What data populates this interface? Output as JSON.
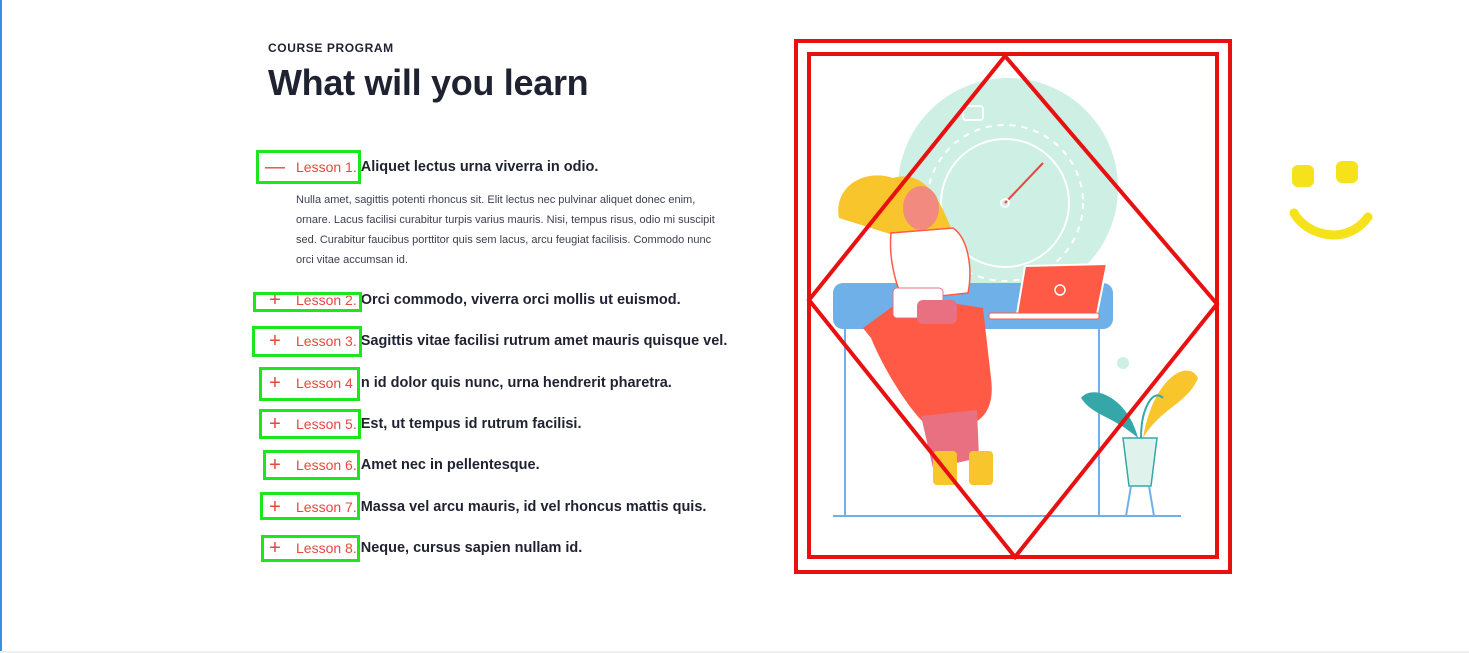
{
  "section": {
    "eyebrow": "COURSE PROGRAM",
    "title": "What will you learn"
  },
  "lessons": [
    {
      "number": "Lesson 1.",
      "title": "Aliquet lectus urna viverra in odio.",
      "toggle": "minus-icon",
      "expanded": true,
      "body": "Nulla amet, sagittis potenti rhoncus sit. Elit lectus nec pulvinar aliquet donec enim, ornare. Lacus facilisi curabitur turpis varius mauris. Nisi, tempus risus, odio mi suscipit sed. Curabitur faucibus porttitor quis sem lacus, arcu feugiat facilisis. Commodo nunc orci vitae accumsan id."
    },
    {
      "number": "Lesson 2.",
      "title": "Orci commodo, viverra orci mollis ut euismod.",
      "toggle": "plus-icon",
      "expanded": false
    },
    {
      "number": "Lesson 3.",
      "title": "Sagittis vitae facilisi rutrum amet mauris quisque vel.",
      "toggle": "plus-icon",
      "expanded": false
    },
    {
      "number": "Lesson 4",
      "title": "In id dolor quis nunc, urna hendrerit pharetra.",
      "toggle": "plus-icon",
      "expanded": false
    },
    {
      "number": "Lesson 5.",
      "title": "Est, ut tempus id rutrum facilisi.",
      "toggle": "plus-icon",
      "expanded": false
    },
    {
      "number": "Lesson 6.",
      "title": "Amet nec in pellentesque.",
      "toggle": "plus-icon",
      "expanded": false
    },
    {
      "number": "Lesson 7.",
      "title": "Massa vel arcu mauris, id vel rhoncus mattis quis.",
      "toggle": "plus-icon",
      "expanded": false
    },
    {
      "number": "Lesson 8.",
      "title": "Neque, cursus sapien nullam id.",
      "toggle": "plus-icon",
      "expanded": false
    }
  ],
  "toggle_glyphs": {
    "minus": "—",
    "plus": "+"
  },
  "colors": {
    "accent": "#e5483e",
    "heading": "#1f2230",
    "annotation_green": "#1ee61e",
    "annotation_red": "#e81010",
    "annotation_yellow": "#f6e21a",
    "illustration_mint": "#cdefe4",
    "illustration_blue": "#6fb0e8",
    "illustration_coral": "#ff5a45",
    "illustration_yellow": "#f8c62c",
    "illustration_teal": "#36a7a8"
  }
}
